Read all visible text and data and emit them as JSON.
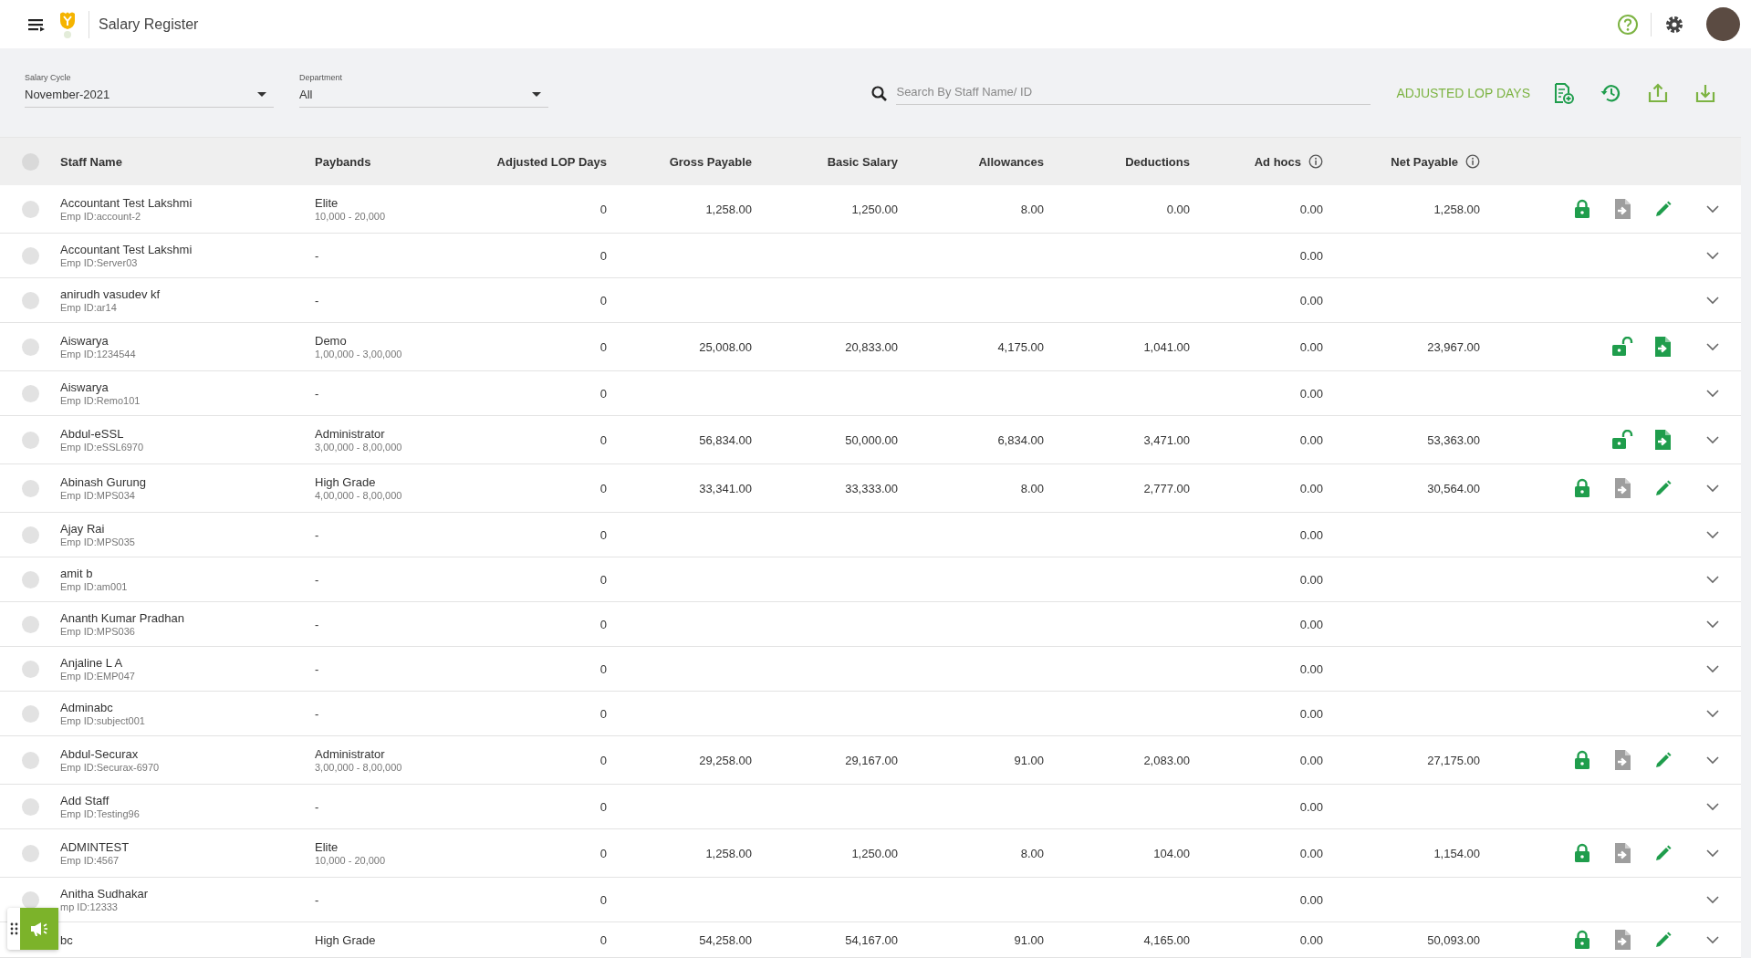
{
  "topbar": {
    "title": "Salary Register"
  },
  "filters": {
    "salary_cycle": {
      "label": "Salary Cycle",
      "value": "November-2021"
    },
    "department": {
      "label": "Department",
      "value": "All"
    },
    "search": {
      "placeholder": "Search By Staff Name/ ID"
    },
    "adjust_link": "ADJUSTED LOP DAYS"
  },
  "table": {
    "select_all_checked": false,
    "columns": [
      {
        "label": "Staff Name",
        "kind": "plain"
      },
      {
        "label": "Paybands",
        "kind": "plain"
      },
      {
        "label": "Adjusted LOP Days",
        "kind": "plain"
      },
      {
        "label": "Gross Payable",
        "kind": "plain"
      },
      {
        "label": "Basic Salary",
        "kind": "plain"
      },
      {
        "label": "Allowances",
        "kind": "plain"
      },
      {
        "label": "Deductions",
        "kind": "plain"
      },
      {
        "label": "Ad hocs",
        "kind": "info"
      },
      {
        "label": "Net Payable",
        "kind": "info"
      }
    ],
    "rows": [
      {
        "checked": false,
        "name": "Accountant Test Lakshmi",
        "emp_id": "Emp ID:account-2",
        "payband": "Elite",
        "payband_range": "10,000 - 20,000",
        "lop": "0",
        "gross": "1,258.00",
        "basic": "1,250.00",
        "allowances": "8.00",
        "deductions": "0.00",
        "adhocs": "0.00",
        "net": "1,258.00",
        "actions": [
          {
            "kind": "locked"
          },
          {
            "kind": "payslip",
            "disabled": true
          },
          {
            "kind": "edit"
          }
        ]
      },
      {
        "checked": false,
        "name": "Accountant Test Lakshmi",
        "emp_id": "Emp ID:Server03",
        "payband": "-",
        "lop": "0",
        "adhocs": "0.00",
        "actions": []
      },
      {
        "checked": false,
        "name": "anirudh vasudev kf",
        "emp_id": "Emp ID:ar14",
        "payband": "-",
        "lop": "0",
        "adhocs": "0.00",
        "actions": []
      },
      {
        "checked": false,
        "name": "Aiswarya",
        "emp_id": "Emp ID:1234544",
        "payband": "Demo",
        "payband_range": "1,00,000 - 3,00,000",
        "lop": "0",
        "gross": "25,008.00",
        "basic": "20,833.00",
        "allowances": "4,175.00",
        "deductions": "1,041.00",
        "adhocs": "0.00",
        "net": "23,967.00",
        "actions": [
          {
            "kind": "unlocked"
          },
          {
            "kind": "payslip",
            "disabled": false
          }
        ]
      },
      {
        "checked": false,
        "name": "Aiswarya",
        "emp_id": "Emp ID:Remo101",
        "payband": "-",
        "lop": "0",
        "adhocs": "0.00",
        "actions": []
      },
      {
        "checked": false,
        "name": "Abdul-eSSL",
        "emp_id": "Emp ID:eSSL6970",
        "payband": "Administrator",
        "payband_range": "3,00,000 - 8,00,000",
        "lop": "0",
        "gross": "56,834.00",
        "basic": "50,000.00",
        "allowances": "6,834.00",
        "deductions": "3,471.00",
        "adhocs": "0.00",
        "net": "53,363.00",
        "actions": [
          {
            "kind": "unlocked"
          },
          {
            "kind": "payslip",
            "disabled": false
          }
        ]
      },
      {
        "checked": false,
        "name": "Abinash Gurung",
        "emp_id": "Emp ID:MPS034",
        "payband": "High Grade",
        "payband_range": "4,00,000 - 8,00,000",
        "lop": "0",
        "gross": "33,341.00",
        "basic": "33,333.00",
        "allowances": "8.00",
        "deductions": "2,777.00",
        "adhocs": "0.00",
        "net": "30,564.00",
        "actions": [
          {
            "kind": "locked"
          },
          {
            "kind": "payslip",
            "disabled": true
          },
          {
            "kind": "edit"
          }
        ]
      },
      {
        "checked": false,
        "name": "Ajay Rai",
        "emp_id": "Emp ID:MPS035",
        "payband": "-",
        "lop": "0",
        "adhocs": "0.00",
        "actions": []
      },
      {
        "checked": false,
        "name": "amit b",
        "emp_id": "Emp ID:am001",
        "payband": "-",
        "lop": "0",
        "adhocs": "0.00",
        "actions": []
      },
      {
        "checked": false,
        "name": "Ananth Kumar Pradhan",
        "emp_id": "Emp ID:MPS036",
        "payband": "-",
        "lop": "0",
        "adhocs": "0.00",
        "actions": []
      },
      {
        "checked": false,
        "name": "Anjaline L A",
        "emp_id": "Emp ID:EMP047",
        "payband": "-",
        "lop": "0",
        "adhocs": "0.00",
        "actions": []
      },
      {
        "checked": false,
        "name": "Adminabc",
        "emp_id": "Emp ID:subject001",
        "payband": "-",
        "lop": "0",
        "adhocs": "0.00",
        "actions": []
      },
      {
        "checked": false,
        "name": "Abdul-Securax",
        "emp_id": "Emp ID:Securax-6970",
        "payband": "Administrator",
        "payband_range": "3,00,000 - 8,00,000",
        "lop": "0",
        "gross": "29,258.00",
        "basic": "29,167.00",
        "allowances": "91.00",
        "deductions": "2,083.00",
        "adhocs": "0.00",
        "net": "27,175.00",
        "actions": [
          {
            "kind": "locked"
          },
          {
            "kind": "payslip",
            "disabled": true
          },
          {
            "kind": "edit"
          }
        ]
      },
      {
        "checked": false,
        "name": "Add Staff",
        "emp_id": "Emp ID:Testing96",
        "payband": "-",
        "lop": "0",
        "adhocs": "0.00",
        "actions": []
      },
      {
        "checked": false,
        "name": "ADMINTEST",
        "emp_id": "Emp ID:4567",
        "payband": "Elite",
        "payband_range": "10,000 - 20,000",
        "lop": "0",
        "gross": "1,258.00",
        "basic": "1,250.00",
        "allowances": "8.00",
        "deductions": "104.00",
        "adhocs": "0.00",
        "net": "1,154.00",
        "actions": [
          {
            "kind": "locked"
          },
          {
            "kind": "payslip",
            "disabled": true
          },
          {
            "kind": "edit"
          }
        ]
      },
      {
        "checked": false,
        "name": "Anitha Sudhakar",
        "emp_id": "mp ID:12333",
        "payband": "-",
        "lop": "0",
        "adhocs": "0.00",
        "actions": []
      },
      {
        "name": "bc",
        "payband": "High Grade",
        "lop": "0",
        "gross": "54,258.00",
        "basic": "54,167.00",
        "allowances": "91.00",
        "deductions": "4,165.00",
        "adhocs": "0.00",
        "net": "50,093.00",
        "actions": [
          {
            "kind": "locked"
          },
          {
            "kind": "payslip",
            "disabled": true
          },
          {
            "kind": "edit"
          }
        ]
      }
    ]
  }
}
